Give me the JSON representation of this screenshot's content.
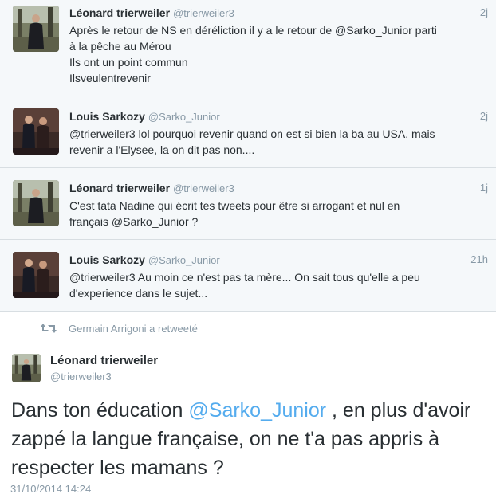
{
  "timeline": {
    "tweets": [
      {
        "name": "Léonard trierweiler",
        "handle": "@trierweiler3",
        "time": "2j",
        "avatar": "forest-figure-avatar",
        "lines": [
          "Après le retour de NS en déréliction il y a le retour de @Sarko_Junior parti",
          "à la pêche au Mérou",
          "Ils ont un point commun",
          "Ilsveulentrevenir"
        ]
      },
      {
        "name": "Louis Sarkozy",
        "handle": "@Sarko_Junior",
        "time": "2j",
        "avatar": "couple-photo-avatar",
        "lines": [
          "@trierweiler3 lol pourquoi revenir quand on est si bien la ba au USA, mais",
          "revenir a l'Elysee, la on dit pas non...."
        ]
      },
      {
        "name": "Léonard trierweiler",
        "handle": "@trierweiler3",
        "time": "1j",
        "avatar": "forest-figure-avatar",
        "lines": [
          "C'est tata Nadine qui écrit tes tweets pour être si arrogant et nul en",
          "français @Sarko_Junior ?"
        ]
      },
      {
        "name": "Louis Sarkozy",
        "handle": "@Sarko_Junior",
        "time": "21h",
        "avatar": "couple-photo-avatar",
        "lines": [
          "@trierweiler3 Au moin ce n'est pas ta mère... On sait tous qu'elle a peu",
          "d'experience dans le sujet..."
        ]
      }
    ]
  },
  "retweet_notice": {
    "icon": "retweet-icon",
    "text": "Germain Arrigoni a retweeté"
  },
  "detail": {
    "name": "Léonard trierweiler",
    "handle": "@trierweiler3",
    "avatar": "forest-figure-avatar",
    "line1_before": "Dans ton éducation ",
    "line1_mention": "@Sarko_Junior",
    "line1_after": " , en plus d'avoir",
    "line2": "zappé la langue française, on ne t'a pas appris à",
    "line3": "respecter les mamans ?",
    "date": "31/10/2014 14:24"
  },
  "colors": {
    "background": "#ffffff",
    "tweet_background": "#f5f8fa",
    "divider": "#d8dee2",
    "text": "#292f33",
    "muted": "#8899a6",
    "link": "#55acee"
  }
}
